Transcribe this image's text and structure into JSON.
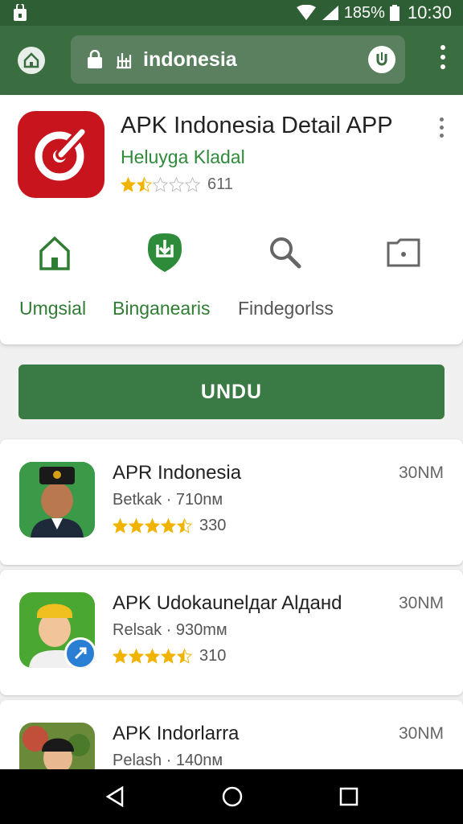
{
  "status_bar": {
    "battery": "185%",
    "time": "10:30"
  },
  "browser": {
    "url": "indonesia"
  },
  "app": {
    "title": "APK Indonesia Detail APP",
    "developer": "Heluyga Kladal",
    "rating_count": "611",
    "stars": 1.5
  },
  "tabs": [
    {
      "label": "Umgsial",
      "icon": "home-icon",
      "color": "#2e7d32"
    },
    {
      "label": "Binganearis",
      "icon": "download-badge-icon",
      "color": "#2e7d32"
    },
    {
      "label": "Findegorlss",
      "icon": "search-icon",
      "color": "#555555"
    }
  ],
  "download_label": "UNDU",
  "list": [
    {
      "title": "APR Indonesia",
      "subtitle": "Betkak · 710nм",
      "rating_count": "330",
      "size": "30NM",
      "stars": 4.5
    },
    {
      "title": "APK Udokaunelдar Alданd",
      "subtitle": "Relsak · 930mм",
      "rating_count": "310",
      "size": "30NM",
      "stars": 4.5
    },
    {
      "title": "APK Indorlarra",
      "subtitle": "Pelash · 140nм",
      "rating_count": "",
      "size": "30NM",
      "stars": 0
    }
  ],
  "colors": {
    "accent": "#3a7a44",
    "star": "#f0b400",
    "brand_red": "#c8141c"
  }
}
